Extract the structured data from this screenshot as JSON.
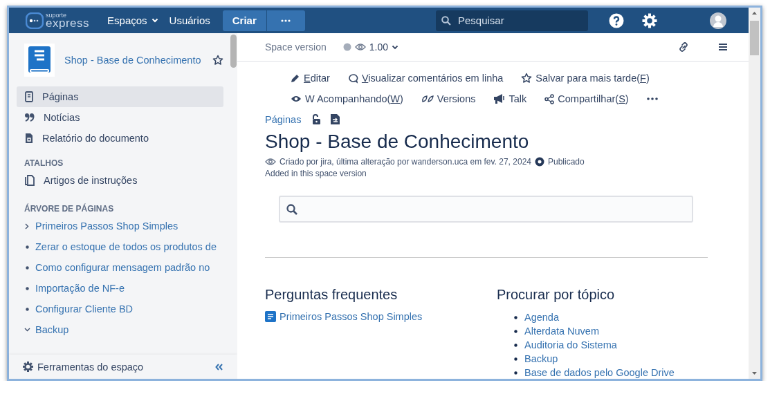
{
  "topbar": {
    "logo": {
      "line1": "suporte",
      "line2": "express"
    },
    "menu": [
      {
        "label": "Espaços",
        "dropdown": true
      },
      {
        "label": "Usuários",
        "dropdown": false
      }
    ],
    "create_button": "Criar",
    "search": {
      "placeholder": "Pesquisar"
    }
  },
  "sidebar": {
    "space_title": "Shop - Base de Conhecimento",
    "starred": false,
    "nav": [
      {
        "label": "Páginas",
        "selected": true
      },
      {
        "label": "Notícias",
        "selected": false
      },
      {
        "label": "Relatório do documento",
        "selected": false
      }
    ],
    "shortcuts_heading": "ATALHOS",
    "shortcuts": [
      "Artigos de instruções"
    ],
    "tree_heading": "ÁRVORE DE PÁGINAS",
    "tree": [
      {
        "label": "Primeiros Passos Shop Simples",
        "kind": "collapsed"
      },
      {
        "label": "Zerar o estoque de todos os produtos de",
        "kind": "leaf"
      },
      {
        "label": "Como configurar mensagem padrão no",
        "kind": "leaf"
      },
      {
        "label": "Importação de NF-e",
        "kind": "leaf"
      },
      {
        "label": "Configurar Cliente BD",
        "kind": "leaf"
      },
      {
        "label": "Backup",
        "kind": "expanded"
      }
    ],
    "footer": "Ferramentas do espaço"
  },
  "main": {
    "space_version": {
      "label": "Space version",
      "value": "1.00"
    },
    "actions": [
      [
        {
          "key": "E",
          "after": "ditar"
        },
        {
          "key": "V",
          "after": "isualizar comentários em linha"
        },
        {
          "before": "Salvar para mais tarde(",
          "key": "F",
          "after": ")"
        }
      ],
      [
        {
          "before": "W Acompanhando(",
          "key": "W",
          "after": ")"
        },
        {
          "before": "Versions"
        },
        {
          "before": "Talk"
        },
        {
          "before": "Compartilhar(",
          "key": "S",
          "after": ")"
        }
      ]
    ],
    "breadcrumb": "Páginas",
    "title": "Shop - Base de Conhecimento",
    "byline": "Criado por jira, última alteração por wanderson.uca em fev. 27, 2024",
    "status": "Publicado",
    "note": "Added in this space version",
    "faq": {
      "heading": "Perguntas frequentes",
      "items": [
        "Primeiros Passos Shop Simples"
      ]
    },
    "topics": {
      "heading": "Procurar por tópico",
      "items": [
        "Agenda",
        "Alterdata Nuvem",
        "Auditoria do Sistema",
        "Backup",
        "Base de dados pelo Google Drive"
      ]
    }
  }
}
